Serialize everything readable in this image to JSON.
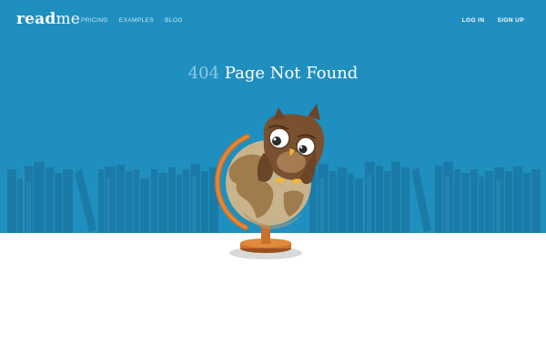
{
  "brand": {
    "logo_bold": "read",
    "logo_light": "me"
  },
  "nav": {
    "links": [
      "PRICING",
      "EXAMPLES",
      "BLOG"
    ]
  },
  "auth": {
    "login": "LOG IN",
    "signup": "SIGN UP"
  },
  "error": {
    "code": "404",
    "message": "Page Not Found"
  },
  "colors": {
    "hero_background": "#1f8fc0",
    "books": "#1b7ba8",
    "books_light": "#2384b1",
    "title_code": "#8cc9e6",
    "page_background": "#ffffff"
  },
  "illustration": {
    "icons": [
      "bookshelf-icon",
      "owl-icon",
      "globe-icon"
    ]
  }
}
